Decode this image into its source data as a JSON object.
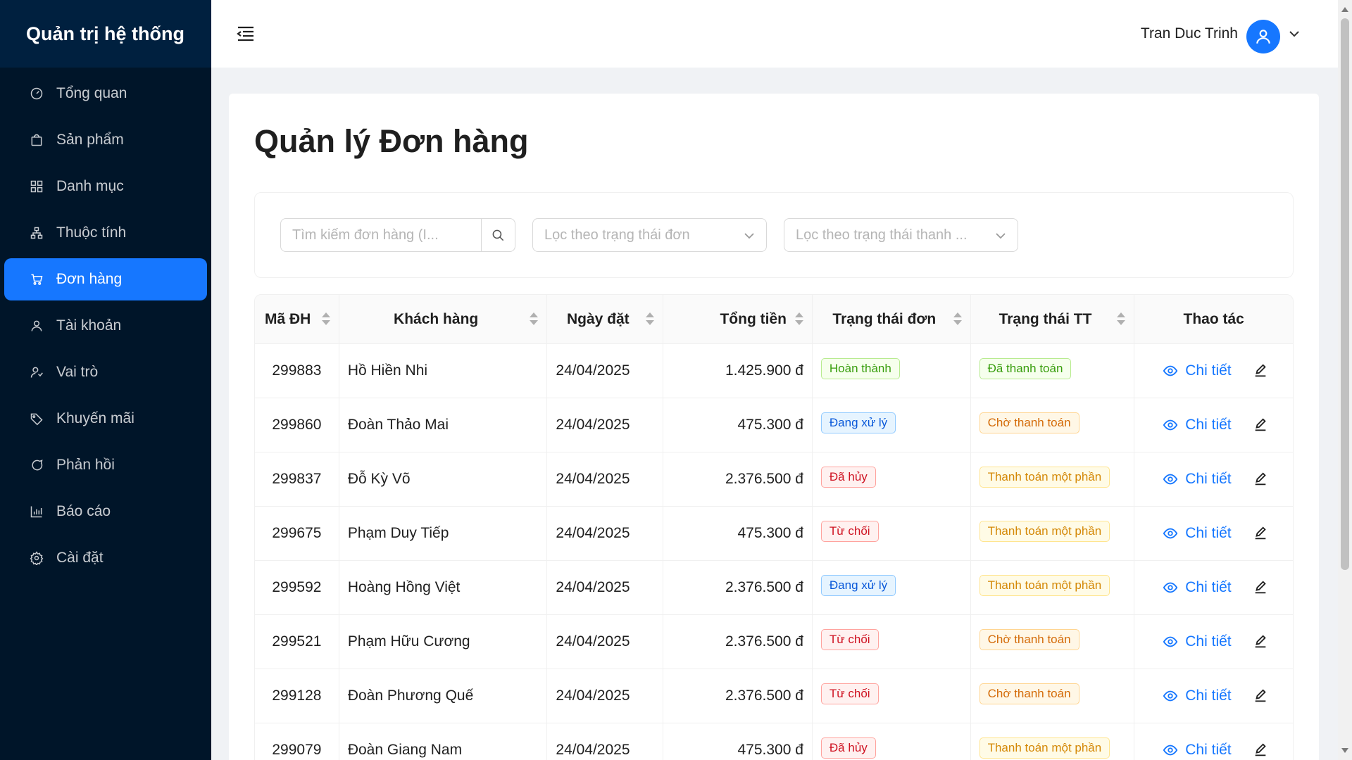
{
  "sidebar": {
    "brand": "Quản trị hệ thống",
    "items": [
      {
        "label": "Tổng quan",
        "icon": "dashboard-icon"
      },
      {
        "label": "Sản phẩm",
        "icon": "shopping-bag-icon"
      },
      {
        "label": "Danh mục",
        "icon": "grid-icon"
      },
      {
        "label": "Thuộc tính",
        "icon": "hierarchy-icon"
      },
      {
        "label": "Đơn hàng",
        "icon": "cart-icon",
        "active": true
      },
      {
        "label": "Tài khoản",
        "icon": "user-icon"
      },
      {
        "label": "Vai trò",
        "icon": "user-role-icon"
      },
      {
        "label": "Khuyến mãi",
        "icon": "tag-icon"
      },
      {
        "label": "Phản hồi",
        "icon": "message-icon"
      },
      {
        "label": "Báo cáo",
        "icon": "bar-chart-icon"
      },
      {
        "label": "Cài đặt",
        "icon": "gear-icon"
      }
    ]
  },
  "header": {
    "user_name": "Tran Duc Trinh"
  },
  "page": {
    "title": "Quản lý Đơn hàng"
  },
  "filters": {
    "search_placeholder": "Tìm kiếm đơn hàng (I...",
    "order_status_placeholder": "Lọc theo trạng thái đơn",
    "payment_status_placeholder": "Lọc theo trạng thái thanh ..."
  },
  "table": {
    "columns": [
      "Mã ĐH",
      "Khách hàng",
      "Ngày đặt",
      "Tổng tiền",
      "Trạng thái đơn",
      "Trạng thái TT",
      "Thao tác"
    ],
    "detail_label": "Chi tiết",
    "rows": [
      {
        "id": "299883",
        "customer": "Hồ Hiền Nhi",
        "date": "24/04/2025",
        "total": "1.425.900 đ",
        "order_status": "Hoàn thành",
        "order_color": "green",
        "pay_status": "Đã thanh toán",
        "pay_color": "green"
      },
      {
        "id": "299860",
        "customer": "Đoàn Thảo Mai",
        "date": "24/04/2025",
        "total": "475.300 đ",
        "order_status": "Đang xử lý",
        "order_color": "blue",
        "pay_status": "Chờ thanh toán",
        "pay_color": "orange"
      },
      {
        "id": "299837",
        "customer": "Đỗ Kỳ Võ",
        "date": "24/04/2025",
        "total": "2.376.500 đ",
        "order_status": "Đã hủy",
        "order_color": "red",
        "pay_status": "Thanh toán một phần",
        "pay_color": "gold"
      },
      {
        "id": "299675",
        "customer": "Phạm Duy Tiếp",
        "date": "24/04/2025",
        "total": "475.300 đ",
        "order_status": "Từ chối",
        "order_color": "red",
        "pay_status": "Thanh toán một phần",
        "pay_color": "gold"
      },
      {
        "id": "299592",
        "customer": "Hoàng Hồng Việt",
        "date": "24/04/2025",
        "total": "2.376.500 đ",
        "order_status": "Đang xử lý",
        "order_color": "blue",
        "pay_status": "Thanh toán một phần",
        "pay_color": "gold"
      },
      {
        "id": "299521",
        "customer": "Phạm Hữu Cương",
        "date": "24/04/2025",
        "total": "2.376.500 đ",
        "order_status": "Từ chối",
        "order_color": "red",
        "pay_status": "Chờ thanh toán",
        "pay_color": "orange"
      },
      {
        "id": "299128",
        "customer": "Đoàn Phương Quế",
        "date": "24/04/2025",
        "total": "2.376.500 đ",
        "order_status": "Từ chối",
        "order_color": "red",
        "pay_status": "Chờ thanh toán",
        "pay_color": "orange"
      },
      {
        "id": "299079",
        "customer": "Đoàn Giang Nam",
        "date": "24/04/2025",
        "total": "475.300 đ",
        "order_status": "Đã hủy",
        "order_color": "red",
        "pay_status": "Thanh toán một phần",
        "pay_color": "gold"
      }
    ]
  },
  "colors": {
    "sidebar_bg": "#001529",
    "accent": "#1677ff"
  }
}
